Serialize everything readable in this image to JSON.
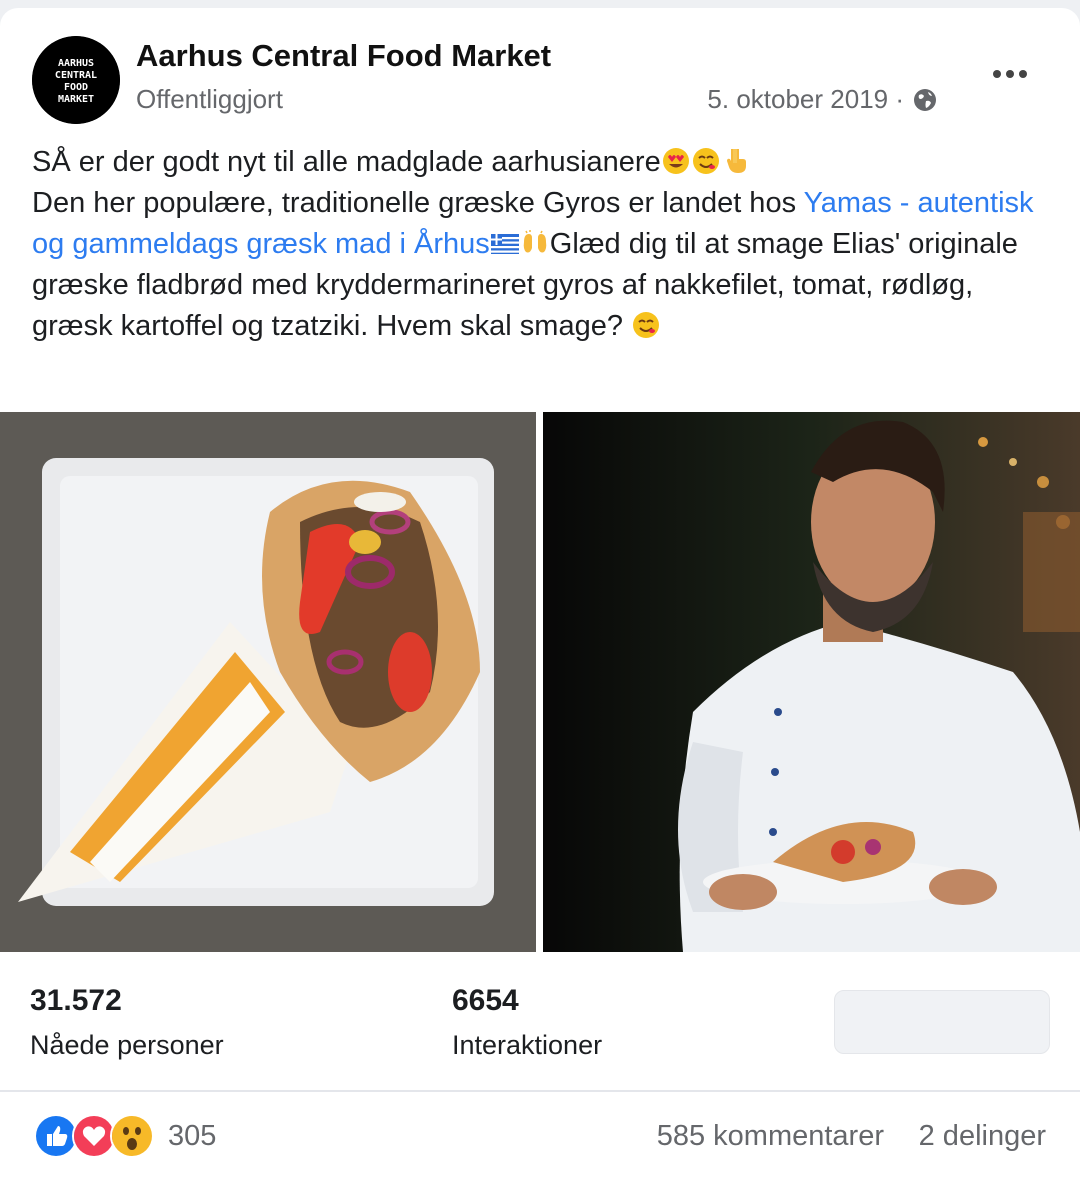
{
  "post": {
    "page_name": "Aarhus Central Food Market",
    "avatar_text": [
      "AARHUS",
      "CENTRAL",
      "FOOD",
      "MARKET"
    ],
    "status": "Offentliggjort",
    "date": "5. oktober 2019 ·",
    "text_line1": "SÅ er der godt nyt til alle madglade aarhusianere",
    "text_line2_pre": "Den her populære, traditionelle græske Gyros er landet hos ",
    "link_text": "Yamas - autentisk og gammeldags græsk mad i Århus",
    "text_after_link": "Glæd dig til at smage Elias' originale græske fladbrød med kryddermarineret gyros af nakkefilet, tomat, rødløg, græsk kartoffel og tzatziki. Hvem skal smage?",
    "icons": {
      "globe": "globe-icon",
      "more": "more-options-icon"
    }
  },
  "photos": [
    {
      "name": "gyros-on-plate-photo"
    },
    {
      "name": "chef-holding-gyros-photo"
    }
  ],
  "stats": {
    "reach_value": "31.572",
    "reach_label": "Nåede personer",
    "engagement_value": "6654",
    "engagement_label": "Interaktioner"
  },
  "footer": {
    "reactions": [
      "like",
      "love",
      "wow"
    ],
    "reaction_count": "305",
    "comments": "585 kommentarer",
    "shares": "2 delinger"
  },
  "colors": {
    "link": "#2d7cf0",
    "secondary_text": "#65676b",
    "like": "#1877f2",
    "love": "#f33e58",
    "wow": "#f7b928"
  }
}
